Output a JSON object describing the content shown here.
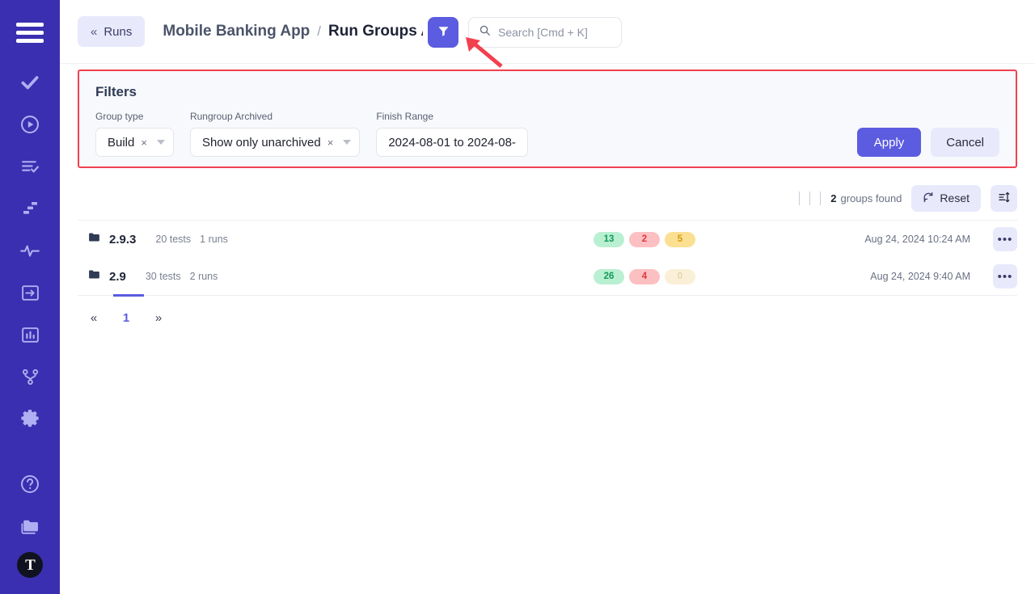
{
  "sidebar": {
    "items": [
      {
        "name": "menu-toggle",
        "icon": "hamburger-icon"
      },
      {
        "name": "tests",
        "icon": "check-icon"
      },
      {
        "name": "runs",
        "icon": "play-circle-icon"
      },
      {
        "name": "test-plans",
        "icon": "list-check-icon"
      },
      {
        "name": "steps",
        "icon": "stairs-icon"
      },
      {
        "name": "activity",
        "icon": "pulse-icon"
      },
      {
        "name": "integrations",
        "icon": "login-box-icon"
      },
      {
        "name": "reports",
        "icon": "bar-chart-icon"
      },
      {
        "name": "branches",
        "icon": "git-branch-icon"
      },
      {
        "name": "settings",
        "icon": "gear-icon"
      },
      {
        "name": "help",
        "icon": "question-circle-icon"
      },
      {
        "name": "projects",
        "icon": "folder-icon"
      },
      {
        "name": "brand",
        "icon": "brand-logo-icon",
        "label": "T"
      }
    ]
  },
  "header": {
    "back_label": "Runs",
    "back_chevron": "«",
    "project": "Mobile Banking App",
    "separator": "/",
    "current": "Run Groups Arc",
    "filter_button": "filter-icon",
    "search": {
      "placeholder": "Search [Cmd + K]"
    }
  },
  "filters": {
    "title": "Filters",
    "fields": [
      {
        "label": "Group type",
        "value": "Build",
        "clear": "×"
      },
      {
        "label": "Rungroup Archived",
        "value": "Show only unarchived",
        "clear": "×"
      },
      {
        "label": "Finish Range",
        "value": "2024-08-01 to 2024-08-"
      }
    ],
    "apply_label": "Apply",
    "cancel_label": "Cancel"
  },
  "toolbar": {
    "count": "2",
    "count_label": "groups found",
    "reset_label": "Reset",
    "sort_icon": "sort-icon"
  },
  "list": {
    "rows": [
      {
        "name": "2.9.3",
        "tests": "20 tests",
        "runs": "1 runs",
        "badges": [
          {
            "value": "13",
            "kind": "pass"
          },
          {
            "value": "2",
            "kind": "fail"
          },
          {
            "value": "5",
            "kind": "skip"
          }
        ],
        "date": "Aug 24, 2024 10:24 AM",
        "menu": "•••"
      },
      {
        "name": "2.9",
        "tests": "30 tests",
        "runs": "2 runs",
        "badges": [
          {
            "value": "26",
            "kind": "pass"
          },
          {
            "value": "4",
            "kind": "fail"
          },
          {
            "value": "0",
            "kind": "zero"
          }
        ],
        "date": "Aug 24, 2024 9:40 AM",
        "menu": "•••"
      }
    ]
  },
  "pagination": {
    "prev": "«",
    "current": "1",
    "next": "»"
  },
  "colors": {
    "sidebar": "#3a2fb0",
    "accent": "#5c5ce0",
    "annotation": "#f2404f",
    "pass": "#b9f0d2",
    "fail": "#fcc0c2",
    "skip": "#fbe093"
  }
}
